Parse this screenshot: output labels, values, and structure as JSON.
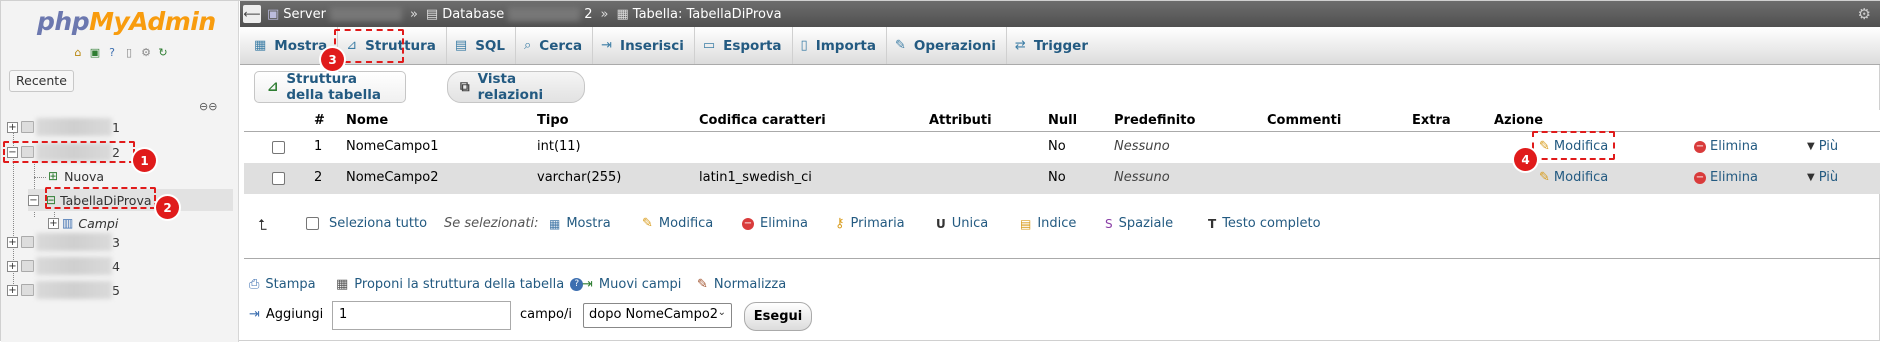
{
  "nav": {
    "logo_php": "php",
    "logo_myadmin": "MyAdmin",
    "recent_label": "Recente",
    "tree": [
      {
        "suffix": "1"
      },
      {
        "suffix": "2"
      },
      {
        "label": "Nuova"
      },
      {
        "label": "TabellaDiProva"
      },
      {
        "label": "Campi"
      },
      {
        "suffix": "3"
      },
      {
        "suffix": "4"
      },
      {
        "suffix": "5"
      }
    ]
  },
  "breadcrumb": {
    "server": "Server",
    "database": "Database",
    "database_suffix": "2",
    "table": "Tabella: TabellaDiProva"
  },
  "tabs": [
    "Mostra",
    "Struttura",
    "SQL",
    "Cerca",
    "Inserisci",
    "Esporta",
    "Importa",
    "Operazioni",
    "Trigger"
  ],
  "subtabs": [
    "Struttura della tabella",
    "Vista relazioni"
  ],
  "table": {
    "headers": [
      "#",
      "Nome",
      "Tipo",
      "Codifica caratteri",
      "Attributi",
      "Null",
      "Predefinito",
      "Commenti",
      "Extra",
      "Azione"
    ],
    "rows": [
      {
        "num": "1",
        "name": "NomeCampo1",
        "type": "int(11)",
        "collation": "",
        "null": "No",
        "default": "Nessuno"
      },
      {
        "num": "2",
        "name": "NomeCampo2",
        "type": "varchar(255)",
        "collation": "latin1_swedish_ci",
        "null": "No",
        "default": "Nessuno"
      }
    ],
    "actions": {
      "edit": "Modifica",
      "drop": "Elimina",
      "more": "Più"
    }
  },
  "bulk": {
    "select_all": "Seleziona tutto",
    "with_selected": "Se selezionati:",
    "items": [
      "Mostra",
      "Modifica",
      "Elimina",
      "Primaria",
      "Unica",
      "Indice",
      "Spaziale",
      "Testo completo"
    ]
  },
  "bottom": {
    "print": "Stampa",
    "propose": "Proponi la struttura della tabella",
    "move": "Muovi campi",
    "normalize": "Normalizza",
    "add_label": "Aggiungi",
    "add_count": "1",
    "fields_label": "campo/i",
    "position_option": "dopo NomeCampo2",
    "go": "Esegui"
  },
  "annotations": [
    "1",
    "2",
    "3",
    "4"
  ],
  "colors": {
    "annotation": "#e01b1b",
    "link": "#235a81",
    "logo_php": "#6c78af",
    "logo_myadmin": "#f89c0e"
  }
}
